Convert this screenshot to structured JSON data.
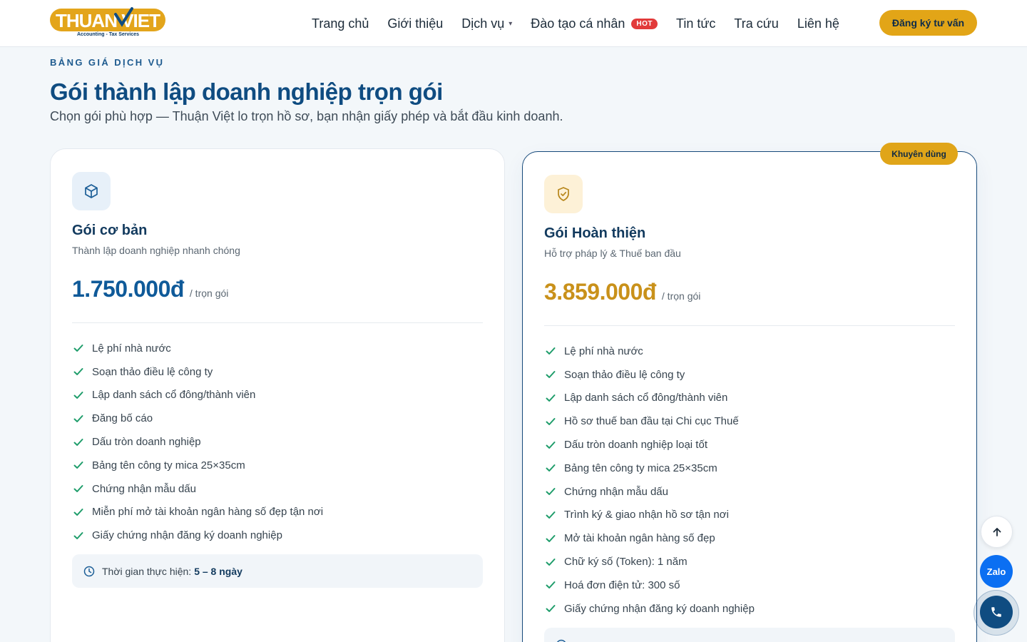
{
  "header": {
    "logo": {
      "main": "THUAN VIET",
      "sub": "Accounting - Tax Services"
    },
    "nav": [
      {
        "label": "Trang chủ"
      },
      {
        "label": "Giới thiệu"
      },
      {
        "label": "Dịch vụ"
      },
      {
        "label": "Đào tạo cá nhân",
        "badge": "HOT"
      },
      {
        "label": "Tin tức"
      },
      {
        "label": "Tra cứu"
      },
      {
        "label": "Liên hệ"
      }
    ],
    "cta_label": "Đăng ký tư vấn"
  },
  "section": {
    "eyebrow": "BẢNG GIÁ DỊCH VỤ",
    "title": "Gói thành lập doanh nghiệp trọn gói",
    "subtitle": "Chọn gói phù hợp — Thuận Việt lo trọn hồ sơ, bạn nhận giấy phép và bắt đầu kinh doanh."
  },
  "plans": [
    {
      "name": "Gói cơ bản",
      "desc": "Thành lập doanh nghiệp nhanh chóng",
      "price": "1.750.000đ",
      "unit": "/ trọn gói",
      "icon": "box-icon",
      "features": [
        "Lệ phí nhà nước",
        "Soạn thảo điều lệ công ty",
        "Lập danh sách cổ đông/thành viên",
        "Đăng bố cáo",
        "Dấu tròn doanh nghiệp",
        "Bảng tên công ty mica 25×35cm",
        "Chứng nhận mẫu dấu",
        "Miễn phí mở tài khoản ngân hàng số đẹp tận nơi",
        "Giấy chứng nhận đăng ký doanh nghiệp"
      ],
      "time_label": "Thời gian thực hiện:",
      "time_value": "5 – 8 ngày"
    },
    {
      "name": "Gói Hoàn thiện",
      "desc": "Hỗ trợ pháp lý & Thuế ban đầu",
      "price": "3.859.000đ",
      "unit": "/ trọn gói",
      "icon": "shield-check-icon",
      "badge": "Khuyên dùng",
      "features": [
        "Lệ phí nhà nước",
        "Soạn thảo điều lệ công ty",
        "Lập danh sách cổ đông/thành viên",
        "Hồ sơ thuế ban đầu tại Chi cục Thuế",
        "Dấu tròn doanh nghiệp loại tốt",
        "Bảng tên công ty mica 25×35cm",
        "Chứng nhận mẫu dấu",
        "Trình ký & giao nhận hồ sơ tận nơi",
        "Mở tài khoản ngân hàng số đẹp",
        "Chữ ký số (Token): 1 năm",
        "Hoá đơn điện tử: 300 số",
        "Giấy chứng nhận đăng ký doanh nghiệp"
      ]
    }
  ],
  "floating": {
    "zalo_label": "Zalo"
  },
  "colors": {
    "primary": "#0f4c81",
    "accent": "#e2a517",
    "check": "#1f9d6b"
  }
}
